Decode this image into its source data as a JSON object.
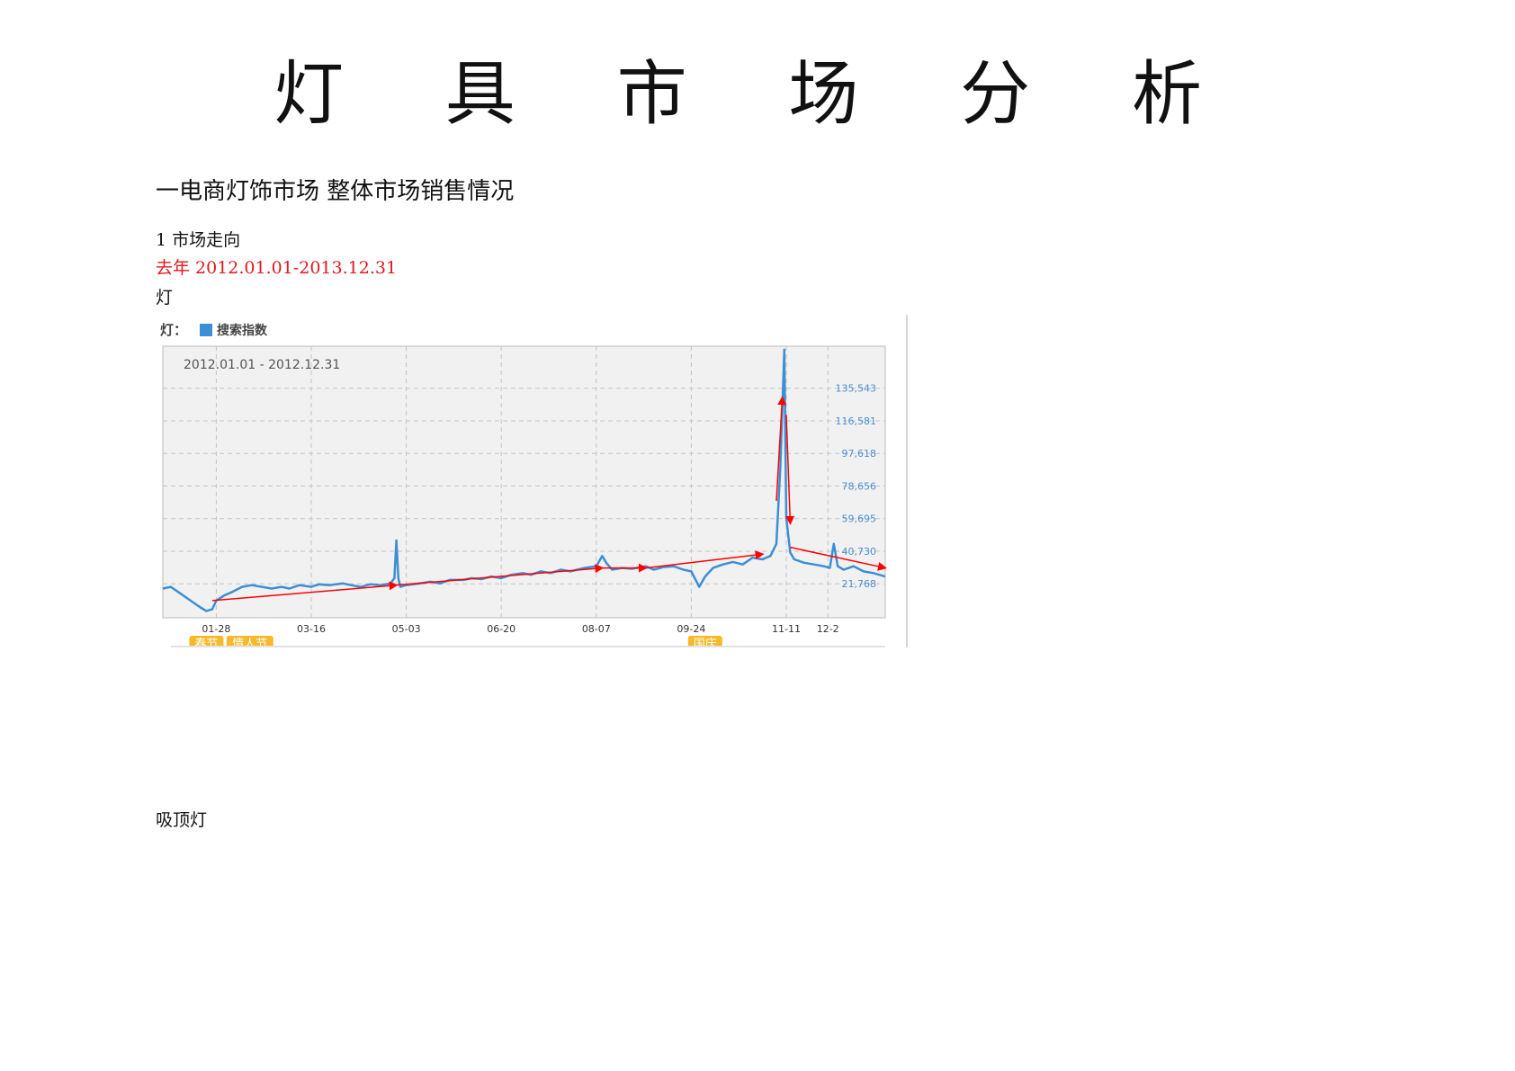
{
  "document": {
    "title": "灯 具 市 场 分 析",
    "section_heading": "一电商灯饰市场 整体市场销售情况",
    "subsection": "1 市场走向",
    "date_range": "去年 2012.01.01-2013.12.31",
    "label_lamp": "灯",
    "label_ceiling_lamp": "吸顶灯"
  },
  "chart_data": {
    "type": "line",
    "heading": "灯：",
    "legend": [
      {
        "name": "搜索指数",
        "color": "#3b8fd6"
      }
    ],
    "date_range_label": "2012.01.01 - 2012.12.31",
    "x_ticks": [
      "01-28",
      "03-16",
      "05-03",
      "06-20",
      "08-07",
      "09-24",
      "11-11",
      "12-2"
    ],
    "y_ticks": [
      "21,768",
      "40,730",
      "59,695",
      "78,656",
      "97,618",
      "116,581",
      "135,543"
    ],
    "ylim": [
      2000,
      160000
    ],
    "holidays": [
      {
        "label": "春节",
        "date": "01-23"
      },
      {
        "label": "情人节",
        "date": "02-14"
      },
      {
        "label": "国庆",
        "date": "10-01"
      }
    ],
    "series": [
      {
        "name": "搜索指数",
        "color": "#3b8fd6",
        "x": [
          "01-01",
          "01-05",
          "01-10",
          "01-15",
          "01-20",
          "01-23",
          "01-26",
          "01-28",
          "02-01",
          "02-05",
          "02-10",
          "02-15",
          "02-20",
          "02-25",
          "03-01",
          "03-05",
          "03-10",
          "03-16",
          "03-20",
          "03-25",
          "04-01",
          "04-05",
          "04-10",
          "04-15",
          "04-20",
          "04-25",
          "04-27",
          "04-28",
          "04-29",
          "04-30",
          "05-03",
          "05-10",
          "05-15",
          "05-20",
          "05-25",
          "06-01",
          "06-05",
          "06-10",
          "06-15",
          "06-20",
          "06-25",
          "07-01",
          "07-05",
          "07-10",
          "07-15",
          "07-20",
          "07-25",
          "08-01",
          "08-07",
          "08-10",
          "08-12",
          "08-15",
          "08-20",
          "08-25",
          "09-01",
          "09-05",
          "09-10",
          "09-15",
          "09-20",
          "09-24",
          "09-28",
          "10-01",
          "10-05",
          "10-10",
          "10-15",
          "10-20",
          "10-25",
          "10-30",
          "11-03",
          "11-06",
          "11-08",
          "11-10",
          "11-11",
          "11-13",
          "11-15",
          "11-20",
          "11-25",
          "11-30",
          "12-03",
          "12-05",
          "12-07",
          "12-10",
          "12-15",
          "12-20",
          "12-25",
          "12-31"
        ],
        "y": [
          19000,
          20000,
          16000,
          12000,
          8000,
          6000,
          7000,
          12000,
          15000,
          17000,
          20000,
          21000,
          20000,
          19000,
          20000,
          19000,
          21000,
          20000,
          21500,
          21000,
          22000,
          21000,
          20000,
          21500,
          21000,
          22000,
          25000,
          47000,
          25000,
          20000,
          21000,
          22000,
          23000,
          22000,
          24000,
          24000,
          25000,
          24500,
          26000,
          25000,
          27000,
          28000,
          27000,
          29000,
          28000,
          30000,
          29000,
          31000,
          32000,
          38000,
          34000,
          30000,
          31000,
          30500,
          32000,
          30000,
          31500,
          32000,
          30000,
          29000,
          20000,
          26000,
          31000,
          33000,
          34500,
          33000,
          37000,
          36000,
          38000,
          45000,
          90000,
          158000,
          60000,
          40000,
          36000,
          34000,
          33000,
          32000,
          31000,
          45000,
          32000,
          30000,
          32000,
          29000,
          28000,
          26000
        ]
      }
    ]
  }
}
